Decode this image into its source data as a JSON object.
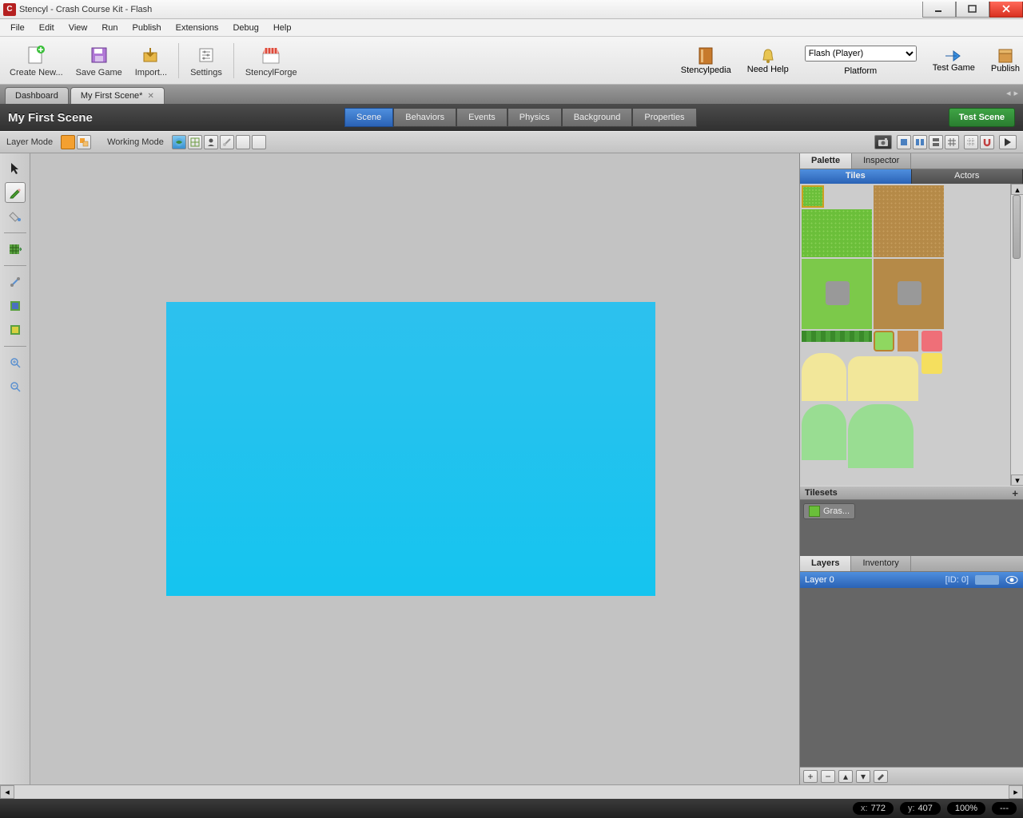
{
  "title": "Stencyl - Crash Course Kit - Flash",
  "menu": [
    "File",
    "Edit",
    "View",
    "Run",
    "Publish",
    "Extensions",
    "Debug",
    "Help"
  ],
  "toolbar": {
    "create": "Create New...",
    "save": "Save Game",
    "import": "Import...",
    "settings": "Settings",
    "forge": "StencylForge",
    "pedia": "Stencylpedia",
    "help": "Need Help",
    "platform_label": "Platform",
    "platform_value": "Flash (Player)",
    "test": "Test Game",
    "publish": "Publish"
  },
  "tabs": {
    "dashboard": "Dashboard",
    "scene": "My First Scene*"
  },
  "scene": {
    "title": "My First Scene",
    "tabs": [
      "Scene",
      "Behaviors",
      "Events",
      "Physics",
      "Background",
      "Properties"
    ],
    "test_btn": "Test Scene"
  },
  "mode": {
    "layer": "Layer Mode",
    "working": "Working Mode"
  },
  "right": {
    "palette": "Palette",
    "inspector": "Inspector",
    "tiles": "Tiles",
    "actors": "Actors",
    "tilesets": "Tilesets",
    "tileset_item": "Gras...",
    "layers": "Layers",
    "inventory": "Inventory",
    "layer0": "Layer 0",
    "layer0_id": "[ID: 0]"
  },
  "status": {
    "x_label": "x:",
    "x": "772",
    "y_label": "y:",
    "y": "407",
    "zoom": "100%",
    "extra": "---"
  }
}
